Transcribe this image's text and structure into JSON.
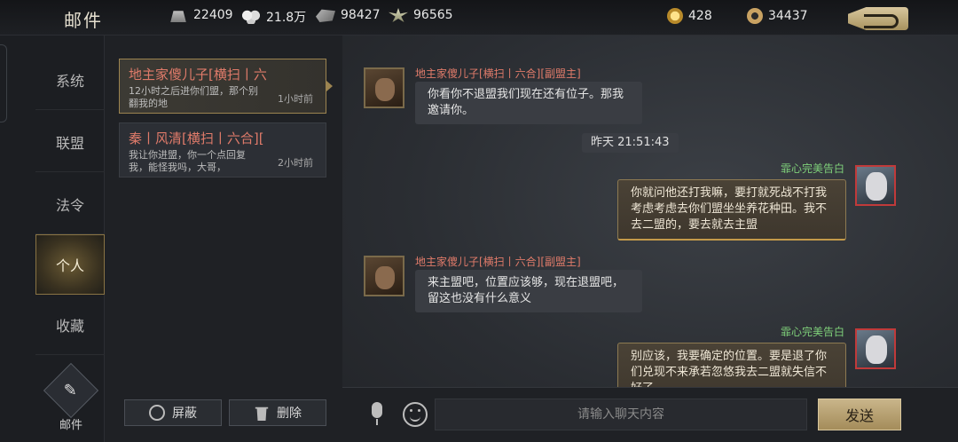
{
  "header": {
    "title": "邮件",
    "resources": [
      {
        "icon": "silver-ingot-icon",
        "value": "22409"
      },
      {
        "icon": "cotton-icon",
        "value": "21.8万"
      },
      {
        "icon": "stone-icon",
        "value": "98427"
      },
      {
        "icon": "grain-icon",
        "value": "96565"
      }
    ],
    "currencies": [
      {
        "icon": "gold-coin-icon",
        "value": "428"
      },
      {
        "icon": "copper-coin-icon",
        "value": "34437"
      }
    ]
  },
  "nav": {
    "items": [
      {
        "label": "系统"
      },
      {
        "label": "联盟"
      },
      {
        "label": "法令"
      },
      {
        "label": "个人",
        "active": true
      },
      {
        "label": "收藏"
      }
    ],
    "mail_label": "邮件"
  },
  "mail_list": {
    "items": [
      {
        "subject": "地主家傻儿子[横扫丨六",
        "preview": "12小时之后进你们盟，那个别翻我的地",
        "time": "1小时前",
        "selected": true
      },
      {
        "subject": "秦丨风清[横扫丨六合][",
        "preview": "我让你进盟，你一个点回复我，能怪我吗，大哥，",
        "time": "2小时前"
      }
    ],
    "block_label": "屏蔽",
    "delete_label": "删除"
  },
  "chat": {
    "messages": [
      {
        "side": "left",
        "sender": "地主家傻儿子[横扫丨六合][副盟主]",
        "text": "你看你不退盟我们现在还有位子。那我邀请你。"
      },
      {
        "side": "right",
        "sender": "霏心完美告白",
        "text": "你就问他还打我嘛，要打就死战不打我考虑考虑去你们盟坐坐养花种田。我不去二盟的，要去就去主盟"
      },
      {
        "side": "left",
        "sender": "地主家傻儿子[横扫丨六合][副盟主]",
        "text": "来主盟吧，位置应该够，现在退盟吧，留这也没有什么意义"
      },
      {
        "side": "right",
        "sender": "霏心完美告白",
        "text": "别应该，我要确定的位置。要是退了你们兑现不来承若忽悠我去二盟就失信不好了"
      }
    ],
    "timestamp": "昨天 21:51:43"
  },
  "input": {
    "placeholder": "请输入聊天内容",
    "value": "",
    "send_label": "发送"
  }
}
